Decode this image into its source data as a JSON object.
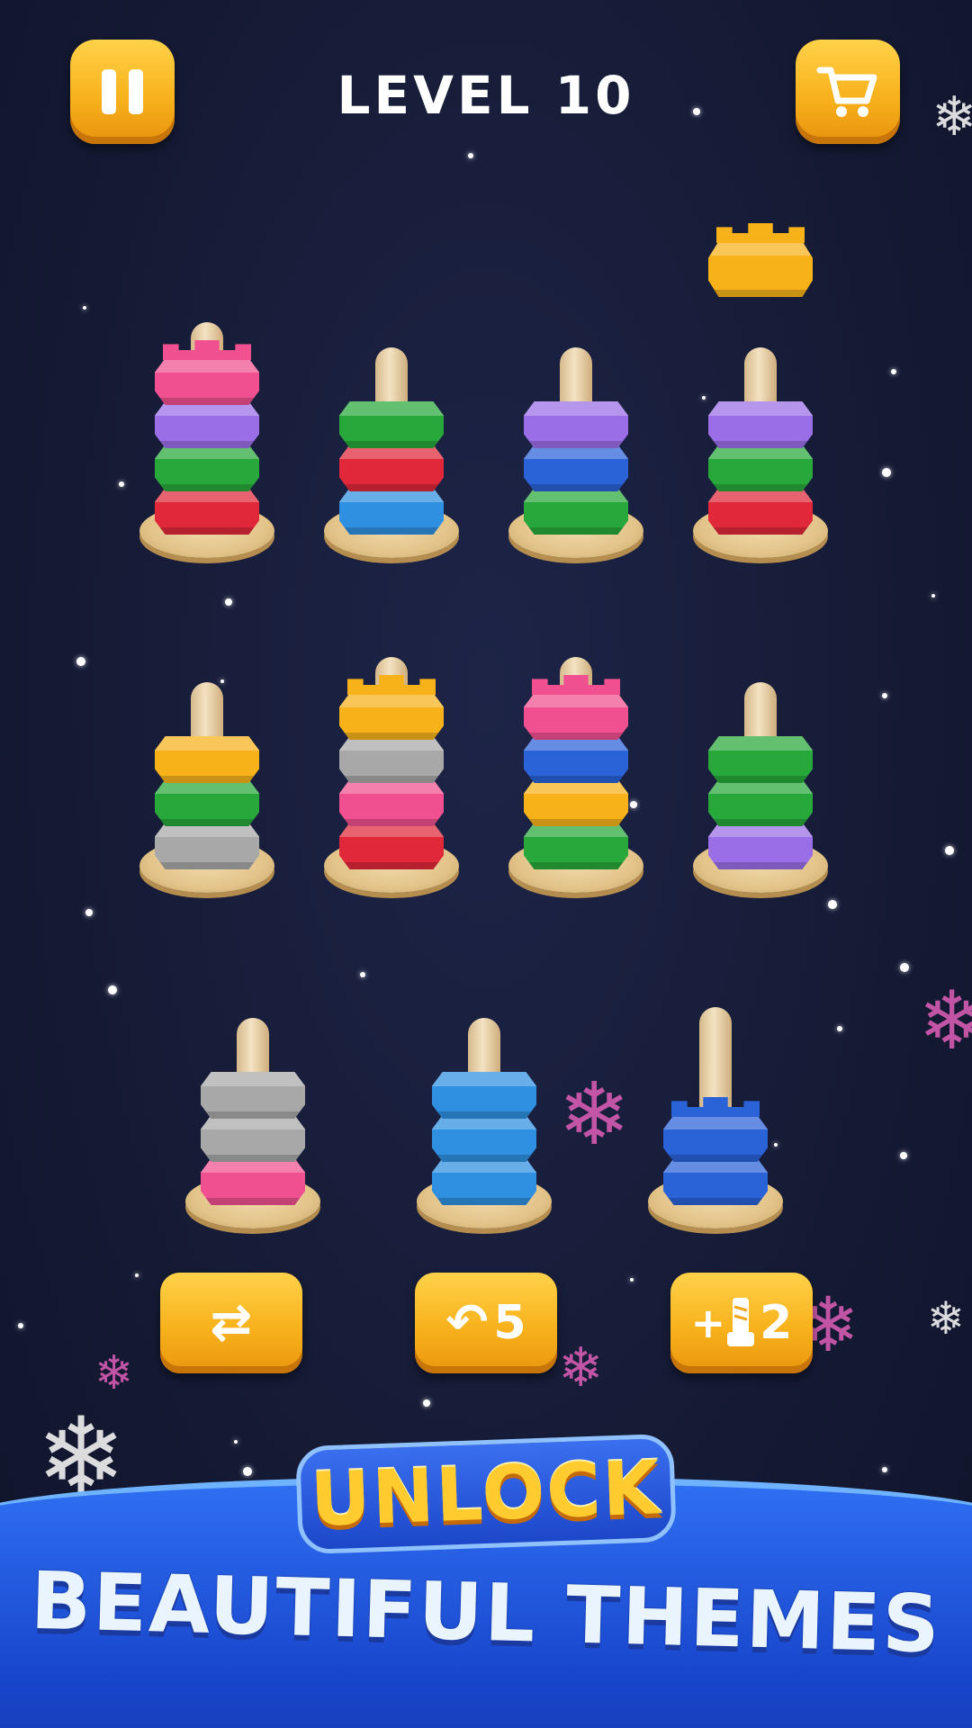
{
  "header": {
    "level_label": "LEVEL  10",
    "pause_icon": "pause-icon",
    "shop_icon": "shopping-cart-icon"
  },
  "colors": {
    "pink": "#f0508f",
    "purple": "#9a6ee6",
    "green": "#28a83a",
    "red": "#e0283a",
    "blue": "#2a62d8",
    "lightblue": "#2f8fe0",
    "yellow": "#f7b21a",
    "gray": "#a8a8a8",
    "button": "#f8b21c",
    "banner": "#1c4fd6"
  },
  "towers": [
    {
      "rings": [
        "red",
        "green",
        "purple",
        "pink"
      ],
      "top_crown": "pink"
    },
    {
      "rings": [
        "lightblue",
        "red",
        "green"
      ],
      "top_crown": null
    },
    {
      "rings": [
        "green",
        "blue",
        "purple"
      ],
      "top_crown": null
    },
    {
      "rings": [
        "red",
        "green",
        "purple"
      ],
      "top_crown": null,
      "lifted": "yellow"
    },
    {
      "rings": [
        "gray",
        "green",
        "yellow"
      ],
      "top_crown": null
    },
    {
      "rings": [
        "red",
        "pink",
        "gray",
        "yellow"
      ],
      "top_crown": "yellow"
    },
    {
      "rings": [
        "green",
        "yellow",
        "blue",
        "pink"
      ],
      "top_crown": "pink"
    },
    {
      "rings": [
        "purple",
        "green",
        "green"
      ],
      "top_crown": null
    },
    {
      "rings": [
        "pink",
        "gray",
        "gray"
      ],
      "top_crown": null
    },
    {
      "rings": [
        "lightblue",
        "lightblue",
        "lightblue"
      ],
      "top_crown": null
    },
    {
      "rings": [
        "blue",
        "blue"
      ],
      "top_crown": "blue"
    }
  ],
  "tools": {
    "shuffle": {
      "icon": "shuffle-icon",
      "glyph": "⇄",
      "count": ""
    },
    "undo": {
      "icon": "undo-icon",
      "glyph": "↶",
      "count": "5"
    },
    "add_bolt": {
      "icon": "add-bolt-icon",
      "glyph": "+",
      "count": "2"
    }
  },
  "banner": {
    "line1": "UNLOCK",
    "line2": "BEAUTIFUL THEMES"
  }
}
